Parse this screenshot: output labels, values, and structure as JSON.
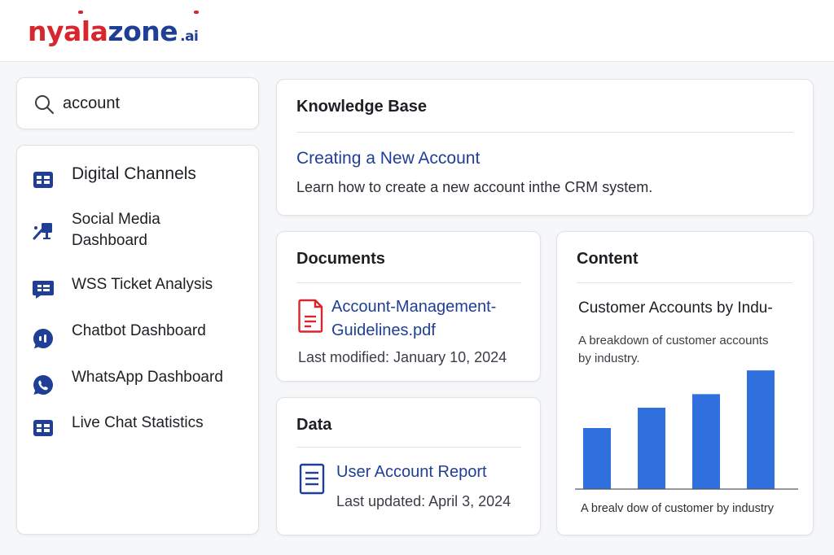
{
  "brand": {
    "logo_part1": "nyala",
    "logo_part2": "zone",
    "logo_suffix": ".ai",
    "colors": {
      "red": "#d8262e",
      "blue": "#1f3f96"
    }
  },
  "search": {
    "icon": "search-icon",
    "value": "account",
    "placeholder": "Search"
  },
  "sidebar": {
    "items": [
      {
        "label": "Digital Channels",
        "icon": "grid-icon"
      },
      {
        "label": "Social Media Dashboard",
        "icon": "social-media-icon"
      },
      {
        "label": "WSS Ticket Analysis",
        "icon": "ticket-icon"
      },
      {
        "label": "Chatbot Dashboard",
        "icon": "chatbot-icon"
      },
      {
        "label": "WhatsApp Dashboard",
        "icon": "whatsapp-icon"
      },
      {
        "label": "Live Chat Statistics",
        "icon": "grid-icon"
      }
    ],
    "icon_color": "#1f3f96"
  },
  "knowledge_base": {
    "title": "Knowledge Base",
    "link": "Creating a New Account",
    "description": "Learn how to create a new account inthe CRM system."
  },
  "documents": {
    "title": "Documents",
    "file_name": "Account-Management-Guidelines.pdf",
    "file_name_line1": "Account-Management-",
    "file_name_line2": "Guidelines.pdf",
    "meta": "Last modified: January 10, 2024",
    "icon": "pdf-file-icon",
    "icon_color": "#d8262e"
  },
  "data_section": {
    "title": "Data",
    "link": "User Account Report",
    "meta": "Last updated: April 3, 2024",
    "icon": "document-icon"
  },
  "content": {
    "title": "Content",
    "chart_title": "Customer Accounts by Indu-",
    "chart_description": "A breakdown of customer accounts by industry.",
    "chart_description_line1": "A breakdown of customer accounts",
    "chart_description_line2": "by industry.",
    "chart_caption": "A brealv dow of customer by industry"
  },
  "chart_data": {
    "type": "bar",
    "title": "Customer Accounts by Indu-",
    "categories": [],
    "values": [
      36,
      48,
      56,
      70
    ],
    "ylim": [
      0,
      72
    ],
    "grid": false,
    "bar_color": "#2f6fde"
  }
}
